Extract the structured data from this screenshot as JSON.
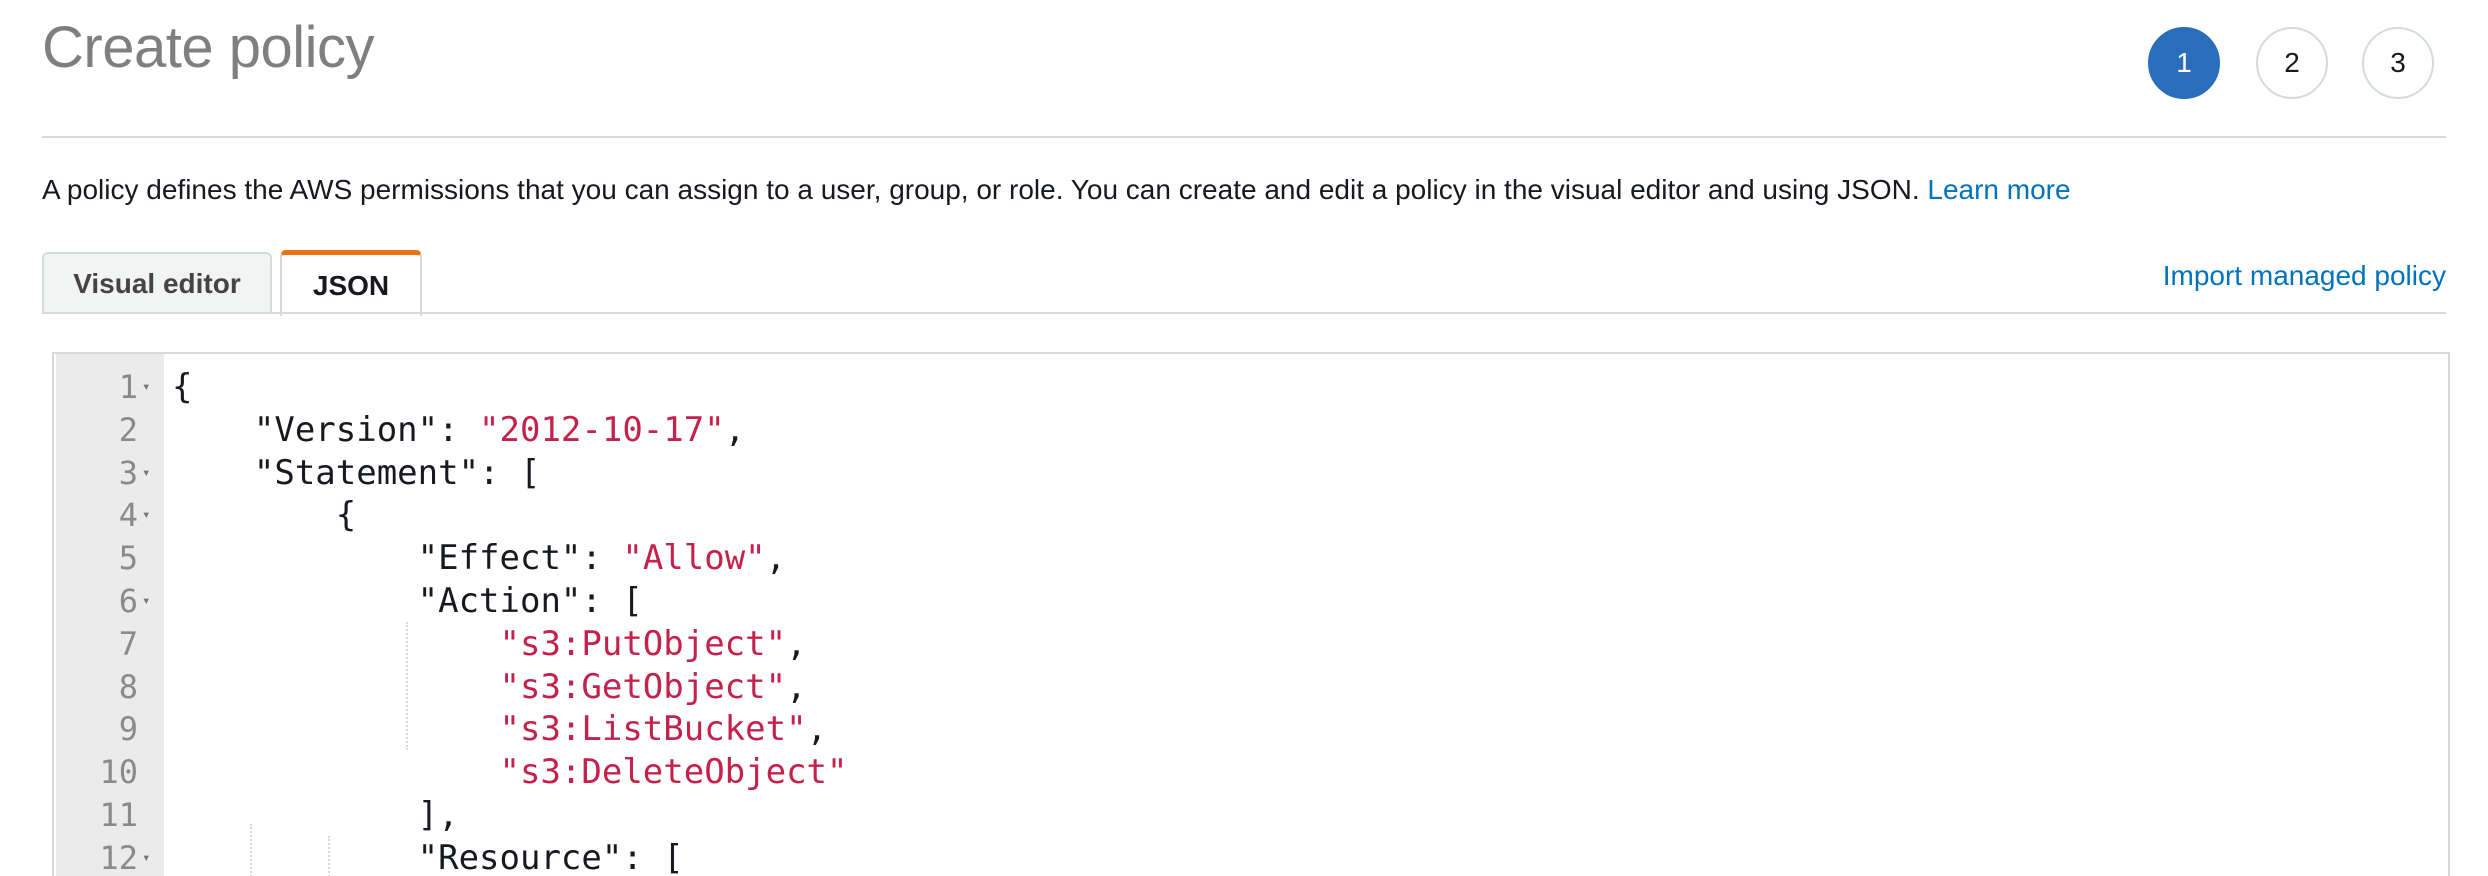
{
  "header": {
    "title": "Create policy",
    "steps": [
      "1",
      "2",
      "3"
    ],
    "active_step": "1"
  },
  "description": {
    "text": "A policy defines the AWS permissions that you can assign to a user, group, or role. You can create and edit a policy in the visual editor and using JSON.",
    "learn_more": "Learn more"
  },
  "tabs": {
    "visual_editor": "Visual editor",
    "json": "JSON",
    "active": "JSON"
  },
  "import_link": "Import managed policy",
  "colors": {
    "accent_blue": "#2a6ebb",
    "link": "#0073bb",
    "tab_active": "#ec7211",
    "string": "#c4214b"
  },
  "editor": {
    "lines": [
      {
        "n": "1",
        "fold": true,
        "parts": [
          {
            "t": "{",
            "c": "p"
          }
        ]
      },
      {
        "n": "2",
        "fold": false,
        "parts": [
          {
            "t": "    \"Version\": ",
            "c": "p"
          },
          {
            "t": "\"2012-10-17\"",
            "c": "s"
          },
          {
            "t": ",",
            "c": "p"
          }
        ]
      },
      {
        "n": "3",
        "fold": true,
        "parts": [
          {
            "t": "    \"Statement\": [",
            "c": "p"
          }
        ]
      },
      {
        "n": "4",
        "fold": true,
        "parts": [
          {
            "t": "        {",
            "c": "p"
          }
        ]
      },
      {
        "n": "5",
        "fold": false,
        "parts": [
          {
            "t": "            \"Effect\": ",
            "c": "p"
          },
          {
            "t": "\"Allow\"",
            "c": "s"
          },
          {
            "t": ",",
            "c": "p"
          }
        ]
      },
      {
        "n": "6",
        "fold": true,
        "parts": [
          {
            "t": "            \"Action\": [",
            "c": "p"
          }
        ]
      },
      {
        "n": "7",
        "fold": false,
        "parts": [
          {
            "t": "                ",
            "c": "p"
          },
          {
            "t": "\"s3:PutObject\"",
            "c": "s"
          },
          {
            "t": ",",
            "c": "p"
          }
        ]
      },
      {
        "n": "8",
        "fold": false,
        "parts": [
          {
            "t": "                ",
            "c": "p"
          },
          {
            "t": "\"s3:GetObject\"",
            "c": "s"
          },
          {
            "t": ",",
            "c": "p"
          }
        ]
      },
      {
        "n": "9",
        "fold": false,
        "parts": [
          {
            "t": "                ",
            "c": "p"
          },
          {
            "t": "\"s3:ListBucket\"",
            "c": "s"
          },
          {
            "t": ",",
            "c": "p"
          }
        ]
      },
      {
        "n": "10",
        "fold": false,
        "parts": [
          {
            "t": "                ",
            "c": "p"
          },
          {
            "t": "\"s3:DeleteObject\"",
            "c": "s"
          }
        ]
      },
      {
        "n": "11",
        "fold": false,
        "parts": [
          {
            "t": "            ],",
            "c": "p"
          }
        ]
      },
      {
        "n": "12",
        "fold": true,
        "parts": [
          {
            "t": "            \"Resource\": [",
            "c": "p"
          }
        ]
      }
    ]
  }
}
